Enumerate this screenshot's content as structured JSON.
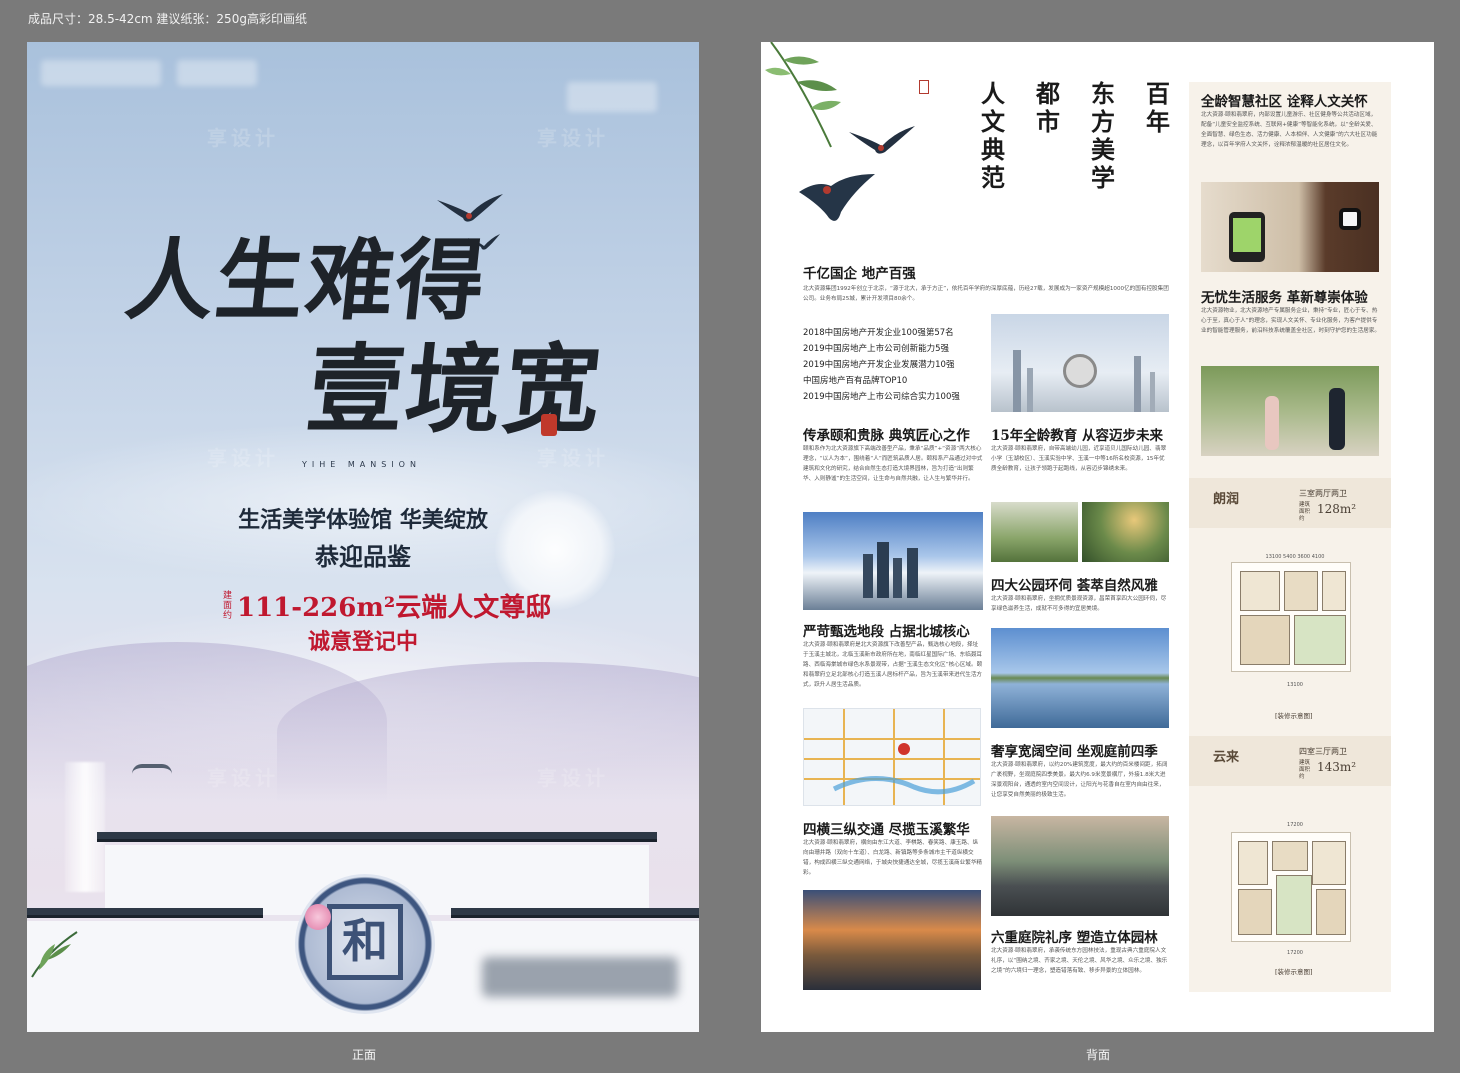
{
  "spec_text": "成品尺寸：28.5-42cm 建议纸张：250g高彩印画纸",
  "captions": {
    "front": "正面",
    "back": "背面"
  },
  "front": {
    "title_line1": "人生难得",
    "title_line2": "壹境宽",
    "brand_en": "YIHE MANSION",
    "slogan1": "生活美学体验馆 华美绽放",
    "slogan2": "恭迎品鉴",
    "area_tag": "建面约",
    "area_text": "111-226m²云端人文尊邸",
    "registration": "诚意登记中",
    "door_glyph": "和",
    "watermark": "享设计"
  },
  "back": {
    "vertical_columns": [
      "百年",
      "东方美学",
      "都市",
      "人文典范"
    ],
    "sections": {
      "company": {
        "title": "千亿国企 地产百强",
        "body": "北大资源集团1992年创立于北京，“源于北大，承于方正”，依托百年学府的深厚底蕴，历经27载，发展成为一家资产规模超1000亿的国有控股集团公司。业务布局25城，累计开发项目80余个。"
      },
      "rankings": [
        "2018中国房地产开发企业100强第57名",
        "2019中国房地产上市公司创新能力5强",
        "2019中国房地产开发企业发展潜力10强",
        "中国房地产百有品牌TOP10",
        "2019中国房地产上市公司综合实力100强"
      ],
      "heritage": {
        "title": "传承颐和贵脉 典筑匠心之作",
        "body": "颐和系作为北大资源旗下高端改善型产品，秉承“品质”+“资源”两大核心理念，“以人为本”，围绕着“人”而匠筑品质人居。颐和系产品通过对中式建筑和文化的研究，结合自然生态打造大境界园林，旨为打造“出则繁华、入则静谧”的生活空间，让生命与自然共融，让人生与繁华并行。"
      },
      "education": {
        "title": "15年全龄教育 从容迈步未来",
        "body": "北大资源·颐和翡翠府，自带高端幼儿园，近享道贝儿国际幼儿园、翡翠小学（玉湖校区）、玉溪实验中学、玉溪一中等16所名校资源，15年优质全龄教育，让孩子领跑于起跑线，从容迈步锦绣未来。"
      },
      "location": {
        "title": "严苛甄选地段 占据北城核心",
        "body": "北大资源·颐和翡翠府是北大资源旗下改善型产品，甄选核心地段，择址于玉溪主城北，北临玉溪新市政府所在地，南临红星国际广场、东临聂耳路、西临海棠城市绿色水系景观带，占据“玉溪生态文化区”核心区域。颐和翡翠府立足北部核心打造玉溪人居标杆产品，旨为玉溪带来进代生活方式，跃升人居生活品质。"
      },
      "parks": {
        "title": "四大公园环伺 荟萃自然风雅",
        "body": "北大资源·颐和翡翠府，坐拥优质景观资源，昌荣首享四大公园环伺，尽享绿色滋养生活，成就不可多得的宜居美境。"
      },
      "traffic": {
        "title": "四横三纵交通 尽揽玉溪繁华",
        "body": "北大资源·颐和翡翠府，横向由东江大道、李棋路、春笑路、康玉路、纵向由珊井路（双向十车道）、白龙路、新镇路等多条城市主干道纵横交错，构成四横三纵交通网络，于城央快捷通达全城，尽揽玉溪商业繁华精彩。"
      },
      "space": {
        "title": "奢享宽阔空间 坐观庭前四季",
        "body": "北大资源·颐和翡翠府，以约20%建筑宽度，最大约的百米楼间距，拓阔广袤视野，坐观庭院四季美景。最大约6.9米宽景横厅，外接1.8米大进深景观阳台，通透的室内空间设计，让阳光与花香自在室内自由往来，让您享受自然美丽的极致生活。"
      },
      "courtyard": {
        "title": "六重庭院礼序 塑造立体园林",
        "body": "北大资源·颐和翡翠府，承袭传统东方园林技法，重现古典六重庭院人文礼序，以“围纳之境、齐家之境、天伦之境、风华之境、众乐之境、独乐之境”的六境归一理念，塑造错落有致、移步异景的立体园林。"
      },
      "community": {
        "title": "全龄智慧社区 诠释人文关怀",
        "body": "北大资源·颐和翡翠府，内部设置儿童游乐、社区健身等公共活动区域，配备“儿童安全监控系统、互联网+健康”等智能化系统，以“全龄关爱、全面智慧、绿色生态、活力健康、人本相伴、人文健康”的六大社区功能理念，以百年学府人文关怀，诠释浓郁温暖的社区居住文化。"
      },
      "service": {
        "title": "无忧生活服务 革新尊崇体验",
        "body": "北大资源物业，北大资源地产专属服务企业，秉持“专业，匠心于专、热心于至，真心于人”的理念，实现人文关怀、专业化服务，为客户提供专业的智能管理服务，前沿科技系统覆盖全社区，时刻守护您的生活居家。"
      }
    },
    "plans": [
      {
        "name": "朗润",
        "type": "三室两厅两卫",
        "area_label": "建筑面积约",
        "area": "128m²",
        "footer": "[装修示意图]"
      },
      {
        "name": "云来",
        "type": "四室三厅两卫",
        "area_label": "建筑面积约",
        "area": "143m²",
        "footer": "[装修示意图]"
      }
    ],
    "plan_dims": {
      "p1_top": [
        "13100",
        "5400",
        "3600",
        "4100"
      ],
      "p1_bottom": [
        "13100"
      ],
      "p2_top": [
        "17200"
      ],
      "p2_bottom": [
        "17200"
      ]
    }
  },
  "colors": {
    "accent_red": "#c0182f",
    "ink": "#1e2329",
    "panel_beige": "#f7f2ea"
  }
}
